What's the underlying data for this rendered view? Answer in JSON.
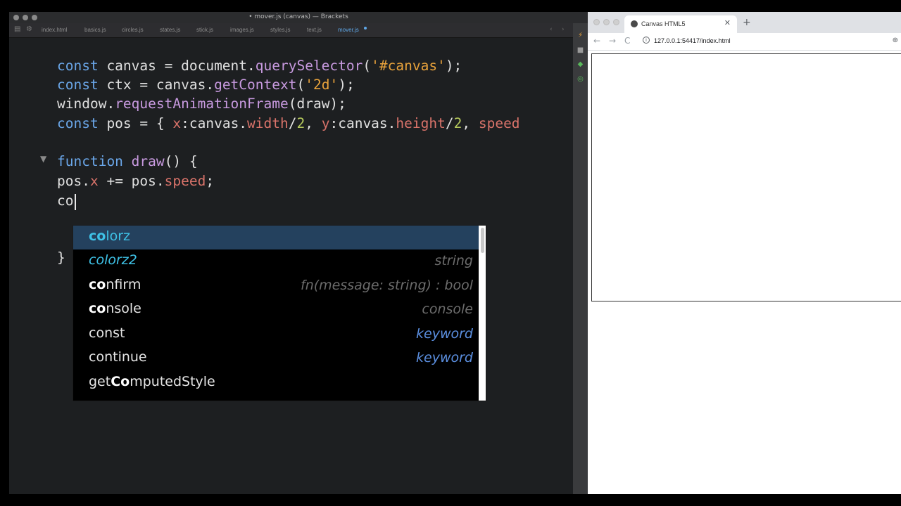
{
  "editor": {
    "window_title": "• mover.js (canvas) — Brackets",
    "tabs": [
      {
        "label": "index.html"
      },
      {
        "label": "basics.js"
      },
      {
        "label": "circles.js"
      },
      {
        "label": "states.js"
      },
      {
        "label": "stick.js"
      },
      {
        "label": "images.js"
      },
      {
        "label": "styles.js"
      },
      {
        "label": "text.js"
      },
      {
        "label": "mover.js",
        "active": true
      }
    ],
    "code": {
      "line1": {
        "t1": "const",
        "t2": " canvas = document.",
        "t3": "querySelector",
        "t4": "(",
        "t5": "'#canvas'",
        "t6": ");"
      },
      "line2": {
        "t1": "const",
        "t2": " ctx = canvas.",
        "t3": "getContext",
        "t4": "(",
        "t5": "'2d'",
        "t6": ");"
      },
      "line3": {
        "t1": "window.",
        "t2": "requestAnimationFrame",
        "t3": "(draw);"
      },
      "line4": {
        "t1": "const",
        "t2": " pos = { ",
        "t3": "x",
        "t4": ":canvas.",
        "t5": "width",
        "t6": "/",
        "t7": "2",
        "t8": ", ",
        "t9": "y",
        "t10": ":canvas.",
        "t11": "height",
        "t12": "/",
        "t13": "2",
        "t14": ", ",
        "t15": "speed"
      },
      "line6": {
        "t1": "function",
        "t2": " ",
        "t3": "draw",
        "t4": "() {"
      },
      "line7": {
        "t1": "pos.",
        "t2": "x",
        "t3": " += pos.",
        "t4": "speed",
        "t5": ";"
      },
      "line8": {
        "t1": "co"
      },
      "line10": {
        "t1": "}"
      }
    },
    "hints": [
      {
        "match": "co",
        "rest": "lorz",
        "type": "",
        "selected": true
      },
      {
        "match": "",
        "rest": "colorz2",
        "type": "string"
      },
      {
        "match": "co",
        "rest": "nfirm",
        "type": "fn(message: string) : bool"
      },
      {
        "match": "co",
        "rest": "nsole",
        "type": "console"
      },
      {
        "match": "",
        "rest": "const",
        "type": "keyword"
      },
      {
        "match": "",
        "rest": "continue",
        "type": "keyword"
      },
      {
        "pre": "get",
        "match": "Co",
        "rest": "mputedStyle",
        "type": ""
      }
    ]
  },
  "browser": {
    "tab_title": "Canvas HTML5",
    "url": "127.0.0.1:54417/index.html",
    "nav": {
      "back": "←",
      "forward": "→",
      "reload": "C",
      "new_tab": "+",
      "close": "✕",
      "zoom": "⊕",
      "info": "i"
    }
  },
  "colors": {
    "editor_bg": "#1d1f21",
    "keyword": "#6aa6e8",
    "function": "#c89ae0",
    "string": "#e8a23b",
    "number": "#b5c95c",
    "property": "#d9736a",
    "hint_selected_bg": "#24415e",
    "hint_match": "#3ec1e6"
  },
  "icons": [
    "fold-arrow-icon",
    "live-preview-icon",
    "extension-manager-icon",
    "globe-icon",
    "info-icon",
    "zoom-icon"
  ]
}
